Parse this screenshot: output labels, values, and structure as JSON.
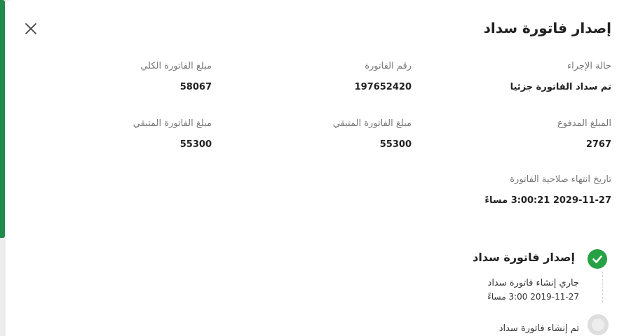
{
  "header": {
    "title": "إصدار فاتورة سداد",
    "close_icon": "close-icon"
  },
  "fields": {
    "status": {
      "label": "حالة الإجراء",
      "value": "تم سداد الفاتورة جزئيا"
    },
    "invoice_number": {
      "label": "رقم الفاتورة",
      "value": "197652420"
    },
    "total_amount": {
      "label": "مبلغ الفاتورة الكلي",
      "value": "58067"
    },
    "paid_amount": {
      "label": "المبلغ المدفوع",
      "value": "2767"
    },
    "remaining_amount_1": {
      "label": "مبلغ الفاتورة المتبقي",
      "value": "55300"
    },
    "remaining_amount_2": {
      "label": "مبلغ الفاتورة المتبقي",
      "value": "55300"
    },
    "expiry_date": {
      "label": "تاريخ انتهاء صلاحية الفاتورة",
      "value": "2029-11-27 3:00:21 مساءً"
    }
  },
  "timeline": {
    "title": "إصدار فاتورة سداد",
    "title_icon": "check-circle-icon",
    "steps": [
      {
        "text": "جاري إنشاء فاتورة سداد",
        "date": "2019-11-27 3:00 مساءً",
        "state": "completed"
      },
      {
        "text": "تم إنشاء فاتورة سداد",
        "state": "pending",
        "icon": "pending-circle-icon"
      }
    ]
  },
  "colors": {
    "accent": "#1f8a4c",
    "success": "#25a244",
    "pending": "#dedede",
    "backdrop": "#ececec"
  }
}
